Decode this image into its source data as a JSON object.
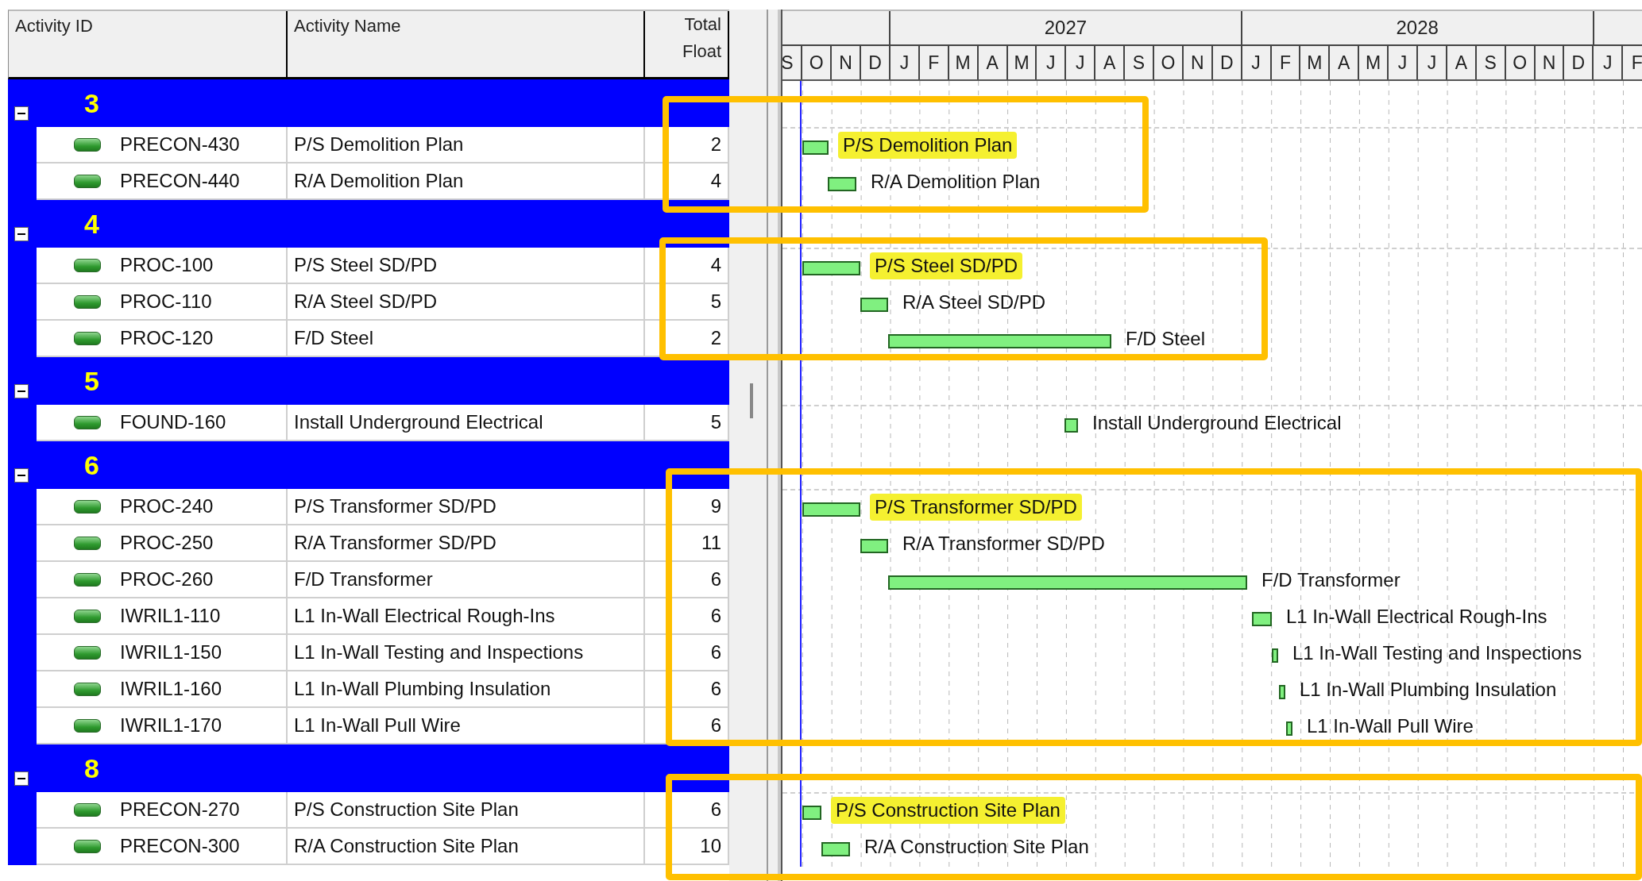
{
  "table": {
    "columns": [
      "Activity ID",
      "Activity Name",
      "Total Float"
    ]
  },
  "timeline": {
    "years": [
      {
        "months": [
          "S",
          "O",
          "N",
          "D"
        ]
      },
      {
        "label": "2027",
        "months": [
          "J",
          "F",
          "M",
          "A",
          "M",
          "J",
          "J",
          "A",
          "S",
          "O",
          "N",
          "D"
        ]
      },
      {
        "label": "2028",
        "months": [
          "J",
          "F",
          "M",
          "A",
          "M",
          "J",
          "J",
          "A",
          "S",
          "O",
          "N",
          "D"
        ]
      },
      {
        "months": [
          "J",
          "F"
        ]
      }
    ]
  },
  "groups": [
    {
      "label": "3",
      "expanded": true,
      "activities": [
        {
          "id": "PRECON-430",
          "name": "P/S Demolition Plan",
          "total_float": "2",
          "bar_label": "P/S Demolition Plan",
          "highlighted": true
        },
        {
          "id": "PRECON-440",
          "name": "R/A Demolition Plan",
          "total_float": "4",
          "bar_label": "R/A Demolition Plan",
          "highlighted": false
        }
      ]
    },
    {
      "label": "4",
      "expanded": true,
      "activities": [
        {
          "id": "PROC-100",
          "name": "P/S Steel SD/PD",
          "total_float": "4",
          "bar_label": "P/S Steel SD/PD",
          "highlighted": true
        },
        {
          "id": "PROC-110",
          "name": "R/A Steel SD/PD",
          "total_float": "5",
          "bar_label": "R/A Steel SD/PD",
          "highlighted": false
        },
        {
          "id": "PROC-120",
          "name": "F/D Steel",
          "total_float": "2",
          "bar_label": "F/D Steel",
          "highlighted": false
        }
      ]
    },
    {
      "label": "5",
      "expanded": true,
      "activities": [
        {
          "id": "FOUND-160",
          "name": "Install Underground Electrical",
          "total_float": "5",
          "bar_label": "Install Underground Electrical",
          "highlighted": false
        }
      ]
    },
    {
      "label": "6",
      "expanded": true,
      "activities": [
        {
          "id": "PROC-240",
          "name": "P/S Transformer SD/PD",
          "total_float": "9",
          "bar_label": "P/S Transformer SD/PD",
          "highlighted": true
        },
        {
          "id": "PROC-250",
          "name": "R/A Transformer SD/PD",
          "total_float": "11",
          "bar_label": "R/A Transformer SD/PD",
          "highlighted": false
        },
        {
          "id": "PROC-260",
          "name": "F/D Transformer",
          "total_float": "6",
          "bar_label": "F/D Transformer",
          "highlighted": false
        },
        {
          "id": "IWRIL1-110",
          "name": "L1 In-Wall Electrical Rough-Ins",
          "total_float": "6",
          "bar_label": "L1 In-Wall Electrical Rough-Ins",
          "highlighted": false
        },
        {
          "id": "IWRIL1-150",
          "name": "L1 In-Wall Testing and Inspections",
          "total_float": "6",
          "bar_label": "L1 In-Wall Testing and Inspections",
          "highlighted": false
        },
        {
          "id": "IWRIL1-160",
          "name": "L1 In-Wall Plumbing Insulation",
          "total_float": "6",
          "bar_label": "L1 In-Wall Plumbing Insulation",
          "highlighted": false
        },
        {
          "id": "IWRIL1-170",
          "name": "L1 In-Wall Pull Wire",
          "total_float": "6",
          "bar_label": "L1 In-Wall Pull Wire",
          "highlighted": false
        }
      ]
    },
    {
      "label": "8",
      "expanded": true,
      "activities": [
        {
          "id": "PRECON-270",
          "name": "P/S Construction Site Plan",
          "total_float": "6",
          "bar_label": "P/S Construction Site Plan",
          "highlighted": true
        },
        {
          "id": "PRECON-300",
          "name": "R/A Construction Site Plan",
          "total_float": "10",
          "bar_label": "R/A Construction Site Plan",
          "highlighted": false
        }
      ]
    }
  ]
}
